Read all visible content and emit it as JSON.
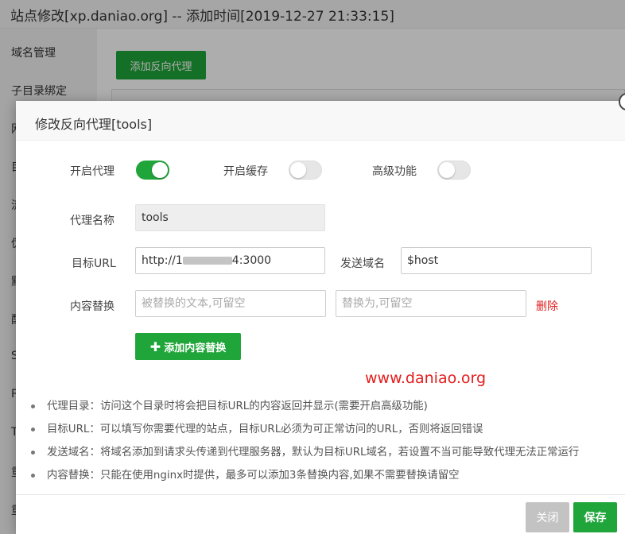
{
  "window": {
    "title": "站点修改[xp.daniao.org] -- 添加时间[2019-12-27 21:33:15]"
  },
  "sidebar": {
    "items": [
      {
        "label": "域名管理"
      },
      {
        "label": "子目录绑定"
      },
      {
        "label": "网"
      },
      {
        "label": "目"
      },
      {
        "label": "流"
      },
      {
        "label": "伪"
      },
      {
        "label": "默"
      },
      {
        "label": "配"
      },
      {
        "label": "S"
      },
      {
        "label": "P"
      },
      {
        "label": "T"
      },
      {
        "label": "重"
      },
      {
        "label": "重"
      }
    ]
  },
  "background": {
    "add_button_label": "添加反向代理"
  },
  "modal": {
    "title": "修改反向代理[tools]",
    "toggles": {
      "proxy": {
        "label": "开启代理",
        "on": true
      },
      "cache": {
        "label": "开启缓存",
        "on": false
      },
      "advanced": {
        "label": "高级功能",
        "on": false
      }
    },
    "proxy_name": {
      "label": "代理名称",
      "value": "tools"
    },
    "target_url": {
      "label": "目标URL",
      "value_prefix": "http://1",
      "value_suffix": "4:3000"
    },
    "send_domain": {
      "label": "发送域名",
      "value": "$host"
    },
    "content_replace": {
      "label": "内容替换",
      "from_placeholder": "被替换的文本,可留空",
      "to_placeholder": "替换为,可留空",
      "delete_label": "删除",
      "add_button_label": "添加内容替换",
      "add_icon": "plus-icon"
    },
    "watermark": "www.daniao.org",
    "tips": [
      "代理目录：访问这个目录时将会把目标URL的内容返回并显示(需要开启高级功能)",
      "目标URL：可以填写你需要代理的站点，目标URL必须为可正常访问的URL，否则将返回错误",
      "发送域名：将域名添加到请求头传递到代理服务器，默认为目标URL域名，若设置不当可能导致代理无法正常运行",
      "内容替换：只能在使用nginx时提供，最多可以添加3条替换内容,如果不需要替换请留空"
    ],
    "footer": {
      "close_label": "关闭",
      "save_label": "保存"
    }
  },
  "colors": {
    "accent": "#20a53a",
    "danger": "#e0201f",
    "disabled": "#c3c3c3",
    "watermark": "#e51c1c"
  }
}
